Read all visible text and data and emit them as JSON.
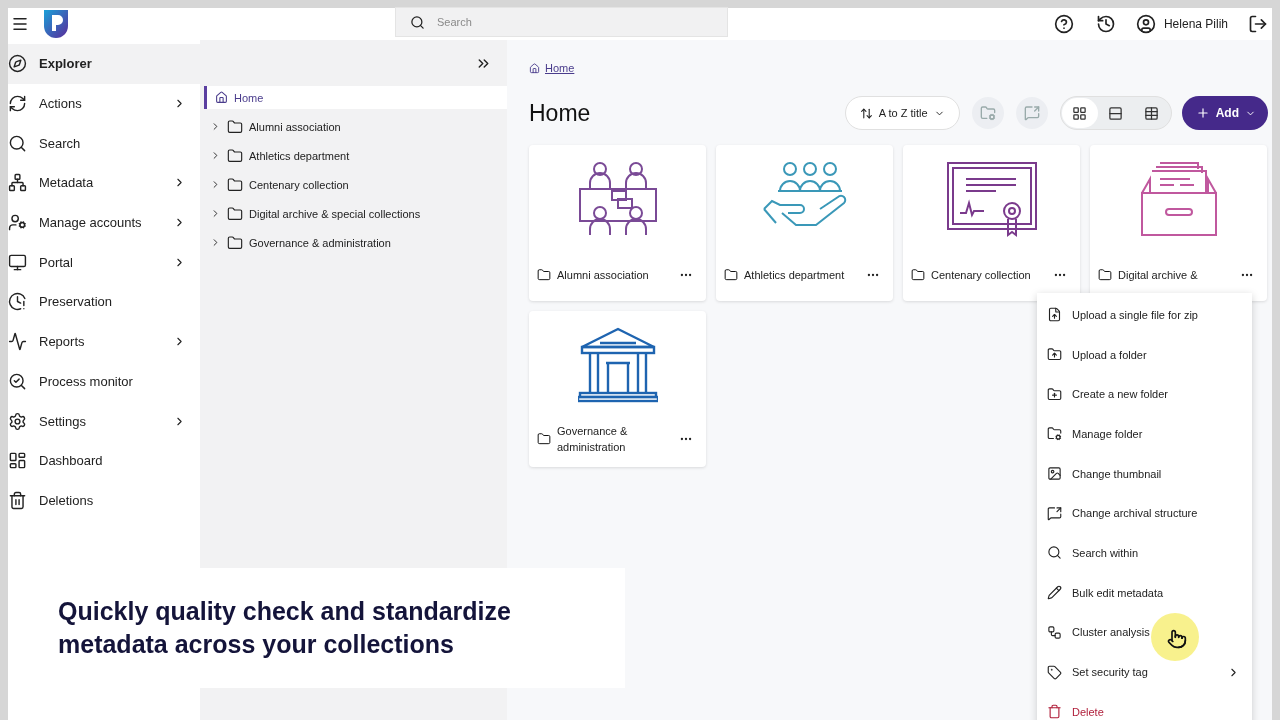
{
  "top_bar": {
    "search": {
      "placeholder": "Search"
    },
    "user_name": "Helena Pilih"
  },
  "nav": [
    {
      "label": "Explorer",
      "selected": true,
      "has_submenu": false
    },
    {
      "label": "Actions",
      "selected": false,
      "has_submenu": true
    },
    {
      "label": "Search",
      "selected": false,
      "has_submenu": false
    },
    {
      "label": "Metadata",
      "selected": false,
      "has_submenu": true
    },
    {
      "label": "Manage accounts",
      "selected": false,
      "has_submenu": true
    },
    {
      "label": "Portal",
      "selected": false,
      "has_submenu": true
    },
    {
      "label": "Preservation",
      "selected": false,
      "has_submenu": false
    },
    {
      "label": "Reports",
      "selected": false,
      "has_submenu": true
    },
    {
      "label": "Process monitor",
      "selected": false,
      "has_submenu": false
    },
    {
      "label": "Settings",
      "selected": false,
      "has_submenu": true
    },
    {
      "label": "Dashboard",
      "selected": false,
      "has_submenu": false
    },
    {
      "label": "Deletions",
      "selected": false,
      "has_submenu": false
    }
  ],
  "tree": {
    "label": "Home",
    "selected": true,
    "children": [
      {
        "label": "Alumni association",
        "expanded": false
      },
      {
        "label": "Athletics department",
        "expanded": false
      },
      {
        "label": "Centenary collection",
        "expanded": false
      },
      {
        "label": "Digital archive & special collections",
        "expanded": false
      },
      {
        "label": "Governance & administration",
        "expanded": false
      }
    ]
  },
  "breadcrumb": "Home",
  "title": "Home",
  "toolbar": {
    "sort": "A to Z title",
    "view_modes": [
      {
        "selected": true
      },
      {
        "selected": false
      },
      {
        "selected": false
      }
    ],
    "add": "Add"
  },
  "folders": [
    {
      "label": "Alumni association"
    },
    {
      "label": "Athletics department"
    },
    {
      "label": "Centenary collection"
    },
    {
      "label": "Digital archive &"
    },
    {
      "label": "Governance & administration"
    }
  ],
  "context_menu": [
    {
      "label": "Upload a single file for zip",
      "kind": "normal",
      "has_submenu": false
    },
    {
      "label": "Upload a folder",
      "kind": "normal",
      "has_submenu": false
    },
    {
      "label": "Create a new folder",
      "kind": "normal",
      "has_submenu": false
    },
    {
      "label": "Manage folder",
      "kind": "normal",
      "has_submenu": false
    },
    {
      "label": "Change thumbnail",
      "kind": "normal",
      "has_submenu": false
    },
    {
      "label": "Change archival structure",
      "kind": "normal",
      "has_submenu": false
    },
    {
      "label": "Search within",
      "kind": "normal",
      "has_submenu": false
    },
    {
      "label": "Bulk edit metadata",
      "kind": "normal",
      "has_submenu": false
    },
    {
      "label": "Cluster analysis",
      "kind": "normal",
      "has_submenu": false
    },
    {
      "label": "Set security tag",
      "kind": "normal",
      "has_submenu": true
    },
    {
      "label": "Delete",
      "kind": "danger",
      "has_submenu": false
    }
  ],
  "caption": {
    "lines": [
      "Quickly quality check and standardize",
      "metadata across your collections"
    ]
  }
}
